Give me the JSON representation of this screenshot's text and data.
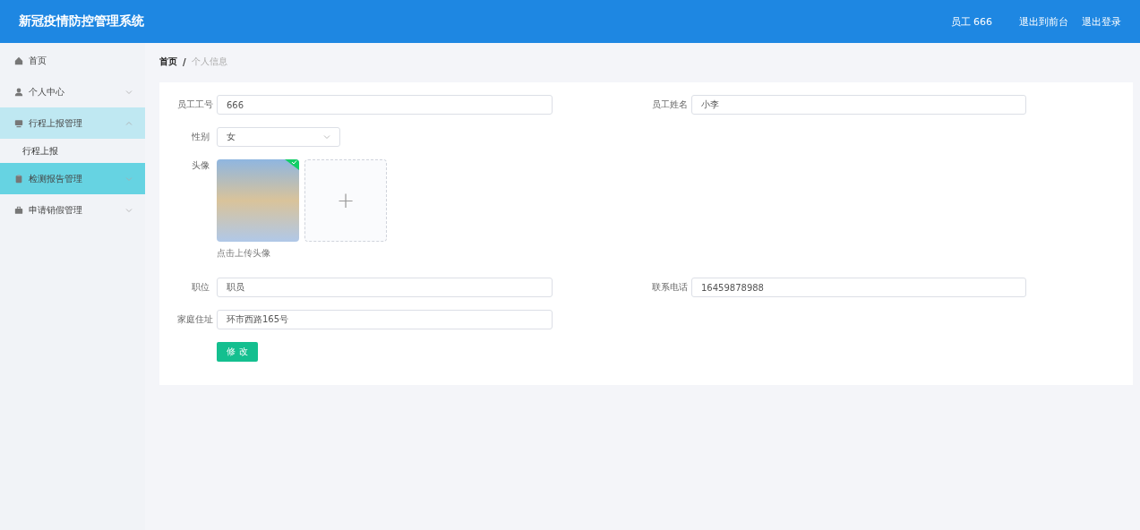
{
  "header": {
    "title": "新冠疫情防控管理系统",
    "user": "员工 666",
    "links": [
      "退出到前台",
      "退出登录"
    ]
  },
  "sidebar": {
    "items": [
      {
        "kind": "link",
        "label": "首页",
        "hovered": false
      },
      {
        "kind": "submenu",
        "label": "个人中心",
        "expanded": false,
        "hovered": false
      },
      {
        "kind": "submenu",
        "label": "行程上报管理",
        "expanded": true,
        "hovered": false,
        "children": [
          {
            "label": "行程上报"
          }
        ]
      },
      {
        "kind": "submenu",
        "label": "检测报告管理",
        "expanded": false,
        "hovered": true
      },
      {
        "kind": "submenu",
        "label": "申请销假管理",
        "expanded": false,
        "hovered": false
      }
    ]
  },
  "breadcrumb": {
    "items": [
      "首页",
      "个人信息"
    ],
    "separator": "/"
  },
  "form": {
    "employee_no": {
      "label": "员工工号",
      "value": "666"
    },
    "employee_name": {
      "label": "员工姓名",
      "value": "小李"
    },
    "gender": {
      "label": "性别",
      "value": "女"
    },
    "avatar": {
      "label": "头像",
      "uploaded": true,
      "hint": "点击上传头像",
      "upload_symbol": "+"
    },
    "position": {
      "label": "职位",
      "value": "职员"
    },
    "phone": {
      "label": "联系电话",
      "value": "16459878988"
    },
    "address": {
      "label": "家庭住址",
      "value": "环市西路165号"
    },
    "submit": "修 改"
  }
}
